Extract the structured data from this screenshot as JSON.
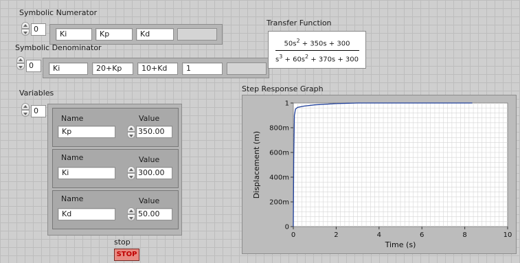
{
  "numerator": {
    "label": "Symbolic Numerator",
    "index": "0",
    "items": [
      "Ki",
      "Kp",
      "Kd",
      ""
    ]
  },
  "denominator": {
    "label": "Symbolic Denominator",
    "index": "0",
    "items": [
      "Ki",
      "20+Kp",
      "10+Kd",
      "1",
      ""
    ]
  },
  "transfer_function": {
    "label": "Transfer Function",
    "numerator": {
      "c2": "50s",
      "e2": "2",
      "rest": " + 350s + 300"
    },
    "denominator": {
      "c3": "s",
      "e3": "3",
      "c2": " + 60s",
      "e2": "2",
      "rest": " + 370s + 300"
    }
  },
  "variables": {
    "label": "Variables",
    "index": "0",
    "name_header": "Name",
    "value_header": "Value",
    "items": [
      {
        "name": "Kp",
        "value": "350.00"
      },
      {
        "name": "Ki",
        "value": "300.00"
      },
      {
        "name": "Kd",
        "value": "50.00"
      }
    ]
  },
  "graph": {
    "label": "Step Response Graph",
    "colors": {
      "plot_bg": "#ffffff",
      "grid": "#d6d6d6",
      "line": "#1f3f9a"
    }
  },
  "chart_data": {
    "type": "line",
    "title": "Step Response Graph",
    "xlabel": "Time (s)",
    "ylabel": "Displacement (m)",
    "xlim": [
      0,
      10
    ],
    "ylim": [
      0,
      1
    ],
    "x_ticks": [
      "0",
      "2",
      "4",
      "6",
      "8",
      "10"
    ],
    "y_ticks": [
      "0",
      "200m",
      "400m",
      "600m",
      "800m",
      "1"
    ],
    "grid": true,
    "series": [
      {
        "x": [
          0,
          0.02,
          0.05,
          0.1,
          0.2,
          0.5,
          1.0,
          2.0,
          3.0,
          4.0,
          5.0,
          6.0,
          7.0,
          8.35
        ],
        "y": [
          0,
          0.55,
          0.9,
          0.95,
          0.965,
          0.975,
          0.985,
          0.995,
          1.0,
          1.0,
          1.0,
          1.0,
          1.0,
          1.0
        ]
      }
    ]
  },
  "stop": {
    "label": "stop",
    "button_label": "STOP"
  }
}
